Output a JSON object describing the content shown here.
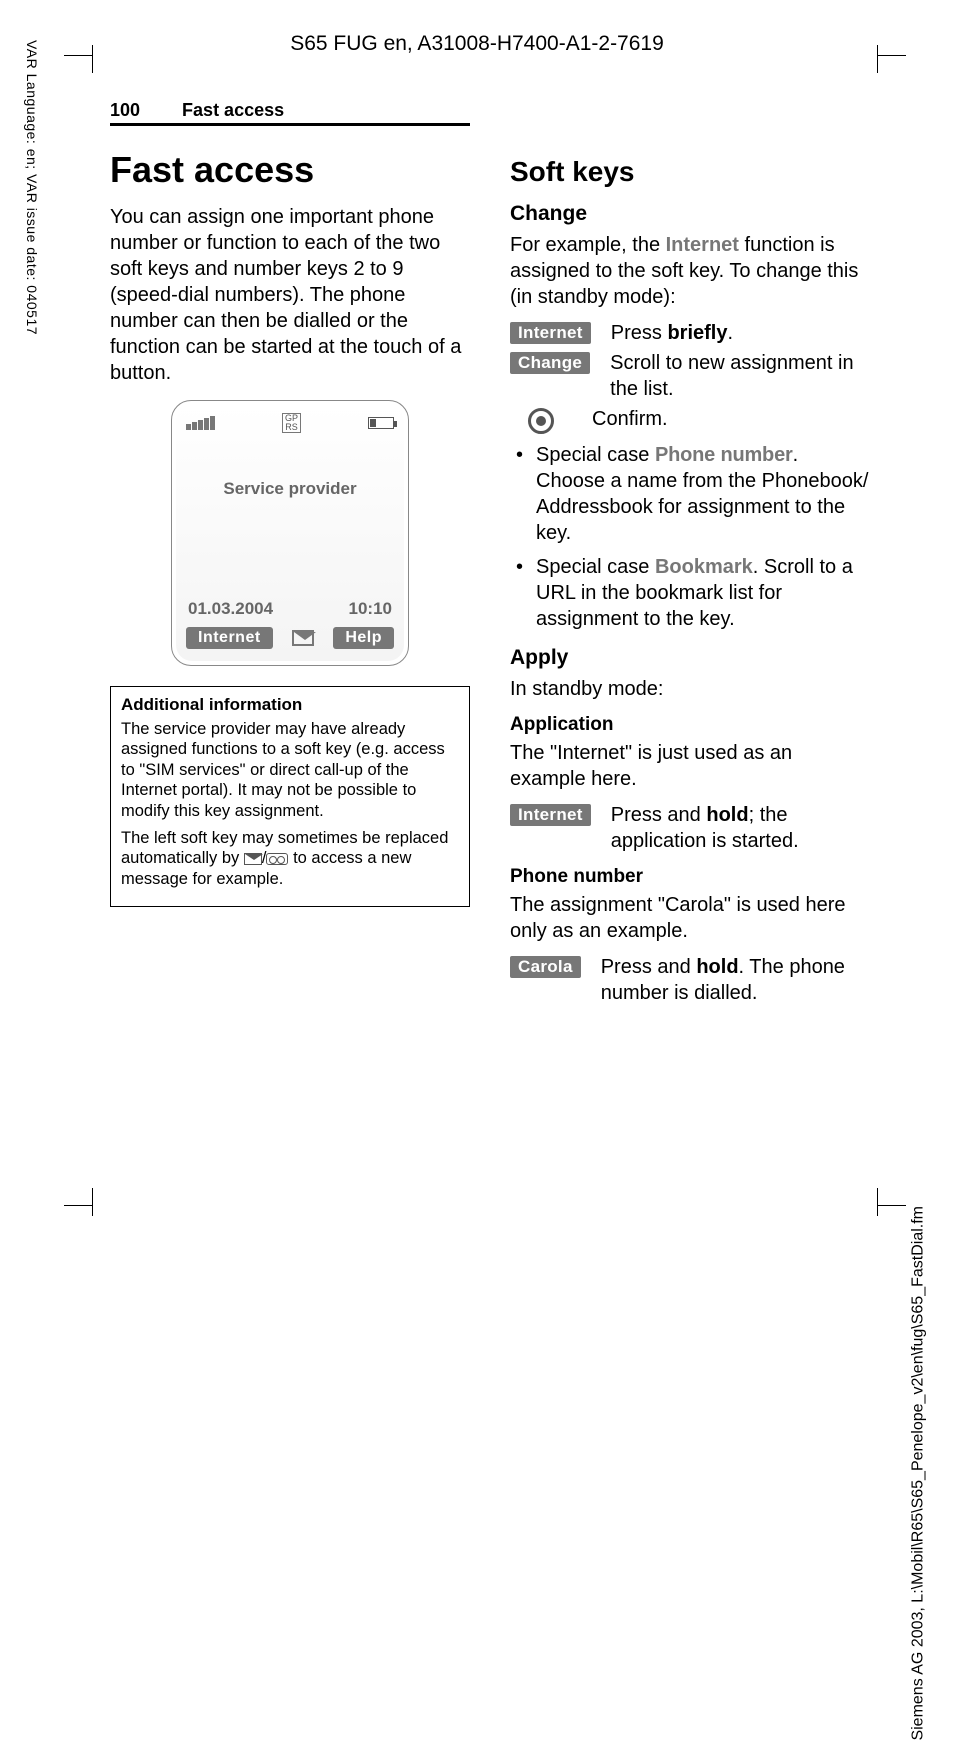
{
  "doc_header": "S65 FUG en, A31008-H7400-A1-2-7619",
  "margin_left": "VAR Language: en; VAR issue date: 040517",
  "margin_right": "Siemens AG 2003, L:\\Mobil\\R65\\S65_Penelope_v2\\en\\fug\\S65_FastDial.fm",
  "running": {
    "page": "100",
    "section": "Fast access"
  },
  "left": {
    "h1": "Fast access",
    "intro": "You can assign one important phone number or function to each of the two soft keys and number keys 2 to 9 (speed-dial numbers). The phone number can then be dialled or the function can be started at the touch of a button.",
    "phone": {
      "gprs": "GP\nRS",
      "provider": "Service provider",
      "date": "01.03.2004",
      "time": "10:10",
      "sk_left": "Internet",
      "sk_right": "Help"
    },
    "infobox": {
      "title": "Additional information",
      "p1": "The service provider may have already assigned functions to a soft key (e.g. access to \"SIM services\" or direct call-up of the Internet portal). It may not be possible to modify this key assignment.",
      "p2a": "The left soft key may sometimes be replaced automatically by ",
      "p2b": " to access a new message for example."
    }
  },
  "right": {
    "h2": "Soft keys",
    "change": {
      "h3": "Change",
      "intro_a": "For example, the ",
      "intro_key": "Internet",
      "intro_b": " function is assigned to the soft key. To change this (in standby mode):",
      "row1_label": "Internet",
      "row1_a": "Press ",
      "row1_b": "briefly",
      "row1_c": ".",
      "row2_label": "Change",
      "row2": "Scroll to new assignment in the list.",
      "row3": "Confirm.",
      "bullet1_a": "Special case ",
      "bullet1_key": "Phone number",
      "bullet1_b": ". Choose a name from the Phonebook/ Addressbook for assignment to the key.",
      "bullet2_a": "Special case ",
      "bullet2_key": "Bookmark",
      "bullet2_b": ". Scroll to a URL in the bookmark list for assignment to the key."
    },
    "apply": {
      "h3": "Apply",
      "intro": "In standby mode:",
      "app_h4": "Application",
      "app_p": "The \"Internet\" is just used as an example here.",
      "app_row_label": "Internet",
      "app_row_a": "Press and ",
      "app_row_b": "hold",
      "app_row_c": "; the application is started.",
      "pn_h4": "Phone number",
      "pn_p": "The assignment \"Carola\" is used here only as an example.",
      "pn_row_label": "Carola",
      "pn_row_a": "Press and ",
      "pn_row_b": "hold",
      "pn_row_c": ". The phone number is dialled."
    }
  }
}
